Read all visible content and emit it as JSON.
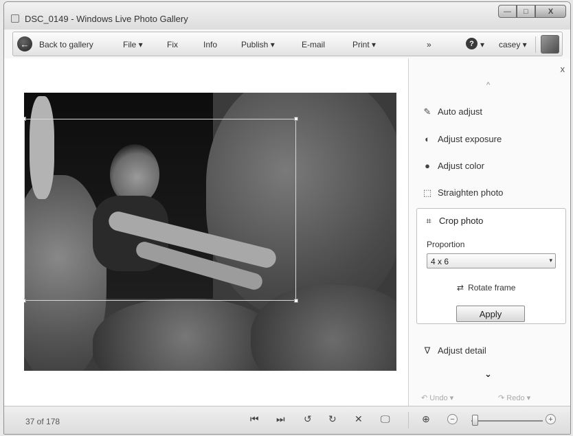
{
  "window": {
    "title": "DSC_0149 - Windows Live Photo Gallery",
    "controls": {
      "minimize": "—",
      "maximize": "□",
      "close": "X"
    }
  },
  "toolbar": {
    "back_label": "Back to gallery",
    "back_icon": "←",
    "file_label": "File ▾",
    "fix_label": "Fix",
    "info_label": "Info",
    "publish_label": "Publish ▾",
    "email_label": "E-mail",
    "print_label": "Print ▾",
    "more_label": "»",
    "help_icon": "?",
    "help_arrow": "▾",
    "user_label": "casey ▾"
  },
  "panel": {
    "close_label": "x",
    "up_arrow": "^",
    "items": [
      {
        "icon": "✎",
        "label": "Auto adjust"
      },
      {
        "icon": "◐",
        "label": "Adjust exposure"
      },
      {
        "icon": "●",
        "label": "Adjust color"
      },
      {
        "icon": "⬚",
        "label": "Straighten photo"
      }
    ],
    "crop": {
      "icon": "⌗",
      "label": "Crop photo",
      "proportion_label": "Proportion",
      "proportion_value": "4 x 6",
      "select_arrow": "▾",
      "rotate_icon": "⇄",
      "rotate_label": "Rotate frame",
      "apply_label": "Apply"
    },
    "adjust_detail": {
      "icon": "∇",
      "label": "Adjust detail"
    },
    "down_arrow": "⌄",
    "undo_label": "↶ Undo ▾",
    "redo_label": "↷ Redo ▾"
  },
  "status": {
    "counter": "37 of 178",
    "controls": {
      "first": "⏮",
      "next": "⏭",
      "rotate_left": "↺",
      "rotate_right": "↻",
      "delete": "✕",
      "slideshow": "🖵",
      "actual_size": "⊕"
    },
    "zoom_minus": "−",
    "zoom_plus": "+",
    "zoom_level": 0.05
  }
}
